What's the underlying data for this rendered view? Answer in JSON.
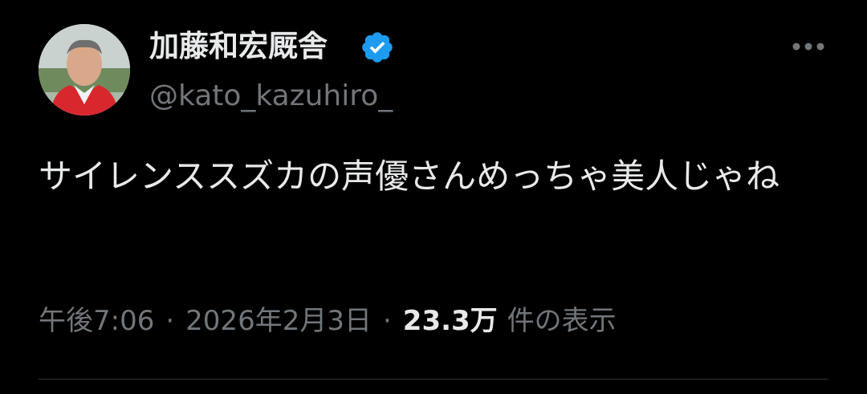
{
  "author": {
    "display_name": "加藤和宏厩舎",
    "handle": "@kato_kazuhiro_",
    "verified": true,
    "avatar_icon": "person-photo-avatar"
  },
  "tweet": {
    "text": "サイレンススズカの声優さんめっちゃ美人じゃね",
    "time": "午後7:06",
    "separator": "·",
    "date": "2026年2月3日",
    "views_count": "23.3万",
    "views_label": "件の表示"
  },
  "icons": {
    "verified": "verified-badge-icon",
    "more": "more-options-icon"
  },
  "colors": {
    "background": "#000000",
    "primary_text": "#e7e9ea",
    "secondary_text": "#71767b",
    "verified_blue": "#1d9bf0",
    "divider": "#2f3336"
  }
}
